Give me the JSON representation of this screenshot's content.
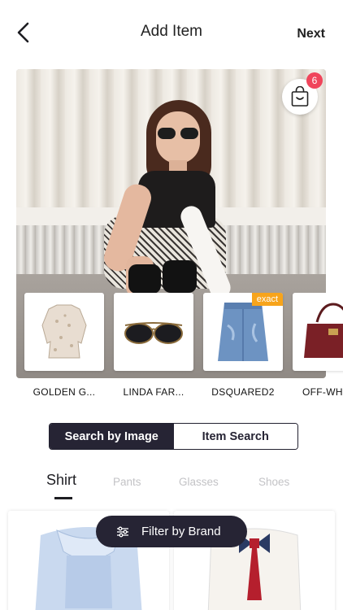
{
  "header": {
    "title": "Add Item",
    "next_label": "Next"
  },
  "hero": {
    "bag_badge_count": "6"
  },
  "products": [
    {
      "label": "GOLDEN G...",
      "icon": "blouse-thumbnail"
    },
    {
      "label": "LINDA FAR...",
      "icon": "sunglasses-thumbnail"
    },
    {
      "label": "DSQUARED2",
      "icon": "denim-skirt-thumbnail",
      "tag": "exact"
    },
    {
      "label": "OFF-WH",
      "icon": "handbag-thumbnail"
    }
  ],
  "segmented": {
    "search_by_image": "Search by Image",
    "item_search": "Item Search"
  },
  "tabs": [
    "Shirt",
    "Pants",
    "Glasses",
    "Shoes"
  ],
  "filter": {
    "label": "Filter by Brand"
  },
  "colors": {
    "accent_dark": "#262434",
    "badge_red": "#f0455b",
    "exact_orange": "#f7a41b"
  }
}
